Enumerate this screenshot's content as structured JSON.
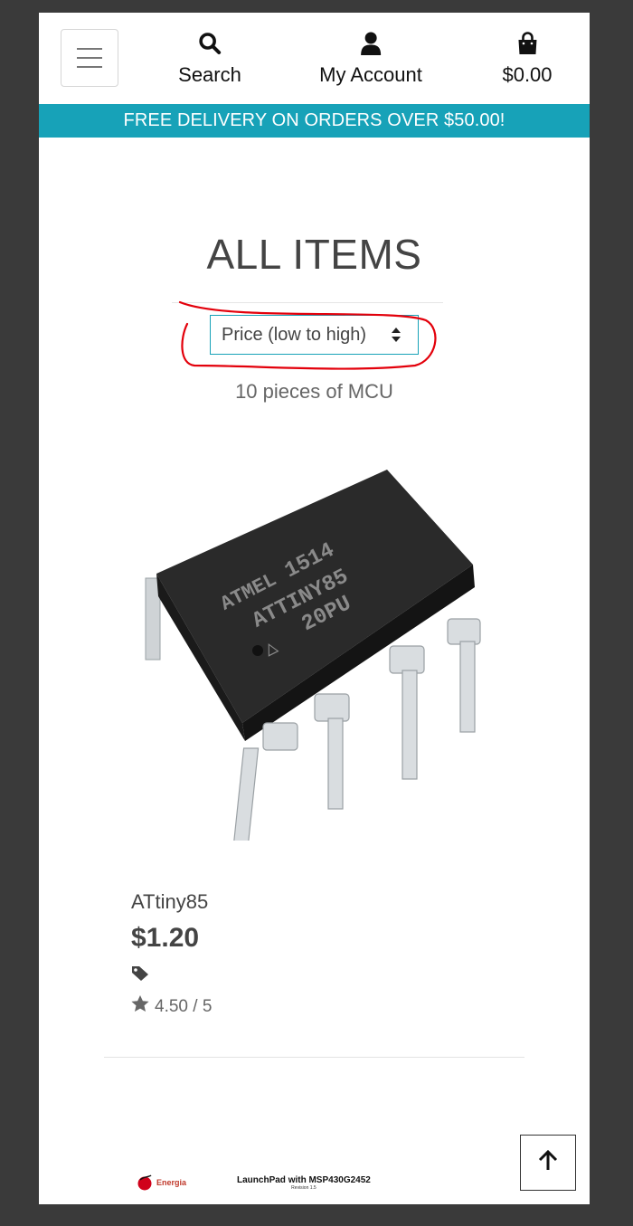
{
  "header": {
    "menu_icon": "hamburger-icon",
    "search": {
      "label": "Search",
      "icon": "search-icon"
    },
    "account": {
      "label": "My Account",
      "icon": "user-icon"
    },
    "bag": {
      "label": "$0.00",
      "icon": "shopping-bag-icon"
    }
  },
  "banner": {
    "text": "FREE DELIVERY ON ORDERS OVER $50.00!"
  },
  "main": {
    "title": "ALL ITEMS",
    "sort": {
      "selected": "Price (low to high)"
    },
    "count_text": "10 pieces of MCU"
  },
  "products": [
    {
      "name": "ATtiny85",
      "price": "$1.20",
      "rating": "4.50 / 5",
      "chip_marking": [
        "1514",
        "ATTINY85",
        "20PU"
      ],
      "chip_brand": "ATMEL"
    }
  ],
  "next_card": {
    "logo_text": "Energia",
    "caption": "LaunchPad with MSP430G2452",
    "caption_sub": "Revision 1.5"
  },
  "colors": {
    "accent": "#17a2b8",
    "annotation": "#e3000b",
    "text": "#444444"
  },
  "back_to_top_icon": "arrow-up-icon"
}
